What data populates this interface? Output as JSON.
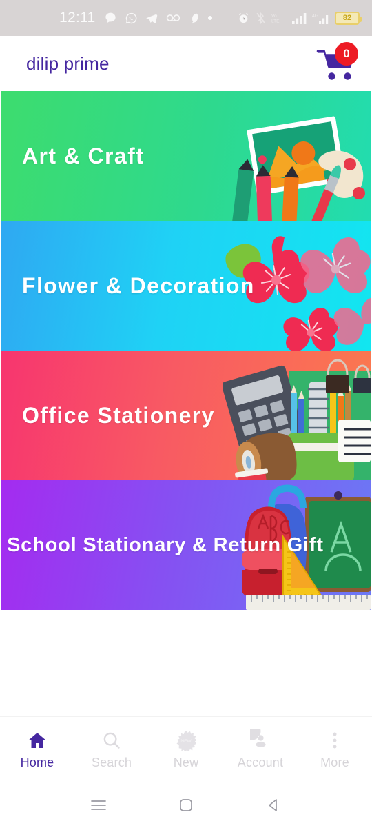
{
  "status_bar": {
    "time": "12:11",
    "battery_level": "82",
    "left_icons": [
      "chat-bubble-icon",
      "whatsapp-icon",
      "telegram-icon",
      "voicemail-icon",
      "feather-icon",
      "dot-icon"
    ],
    "right_icons": [
      "alarm-clock-icon",
      "bluetooth-muted-icon",
      "volte-icon",
      "signal-bars-icon",
      "signal-4g-icon",
      "battery-icon"
    ]
  },
  "app_bar": {
    "title": "dilip prime",
    "cart_icon": "shopping-cart-icon",
    "cart_count": "0",
    "title_color": "#4527a0",
    "badge_color": "#ed1b24"
  },
  "banners": [
    {
      "title": "Art & Craft",
      "art": "art-supplies-illustration",
      "color_start": "#3ddc6e",
      "color_end": "#22dcb0"
    },
    {
      "title": "Flower & Decoration",
      "art": "cherry-blossom-illustration",
      "color_start": "#2fa8f2",
      "color_end": "#12e6f0"
    },
    {
      "title": "Office Stationery",
      "art": "office-supplies-illustration",
      "color_start": "#f7356f",
      "color_end": "#fb7a4e"
    },
    {
      "title": "School Stationary & Return Gift",
      "art": "school-supplies-illustration",
      "color_start": "#a42bf0",
      "color_end": "#6b79f5"
    }
  ],
  "bottom_nav": {
    "active_index": 0,
    "active_color": "#4527a0",
    "inactive_color": "#d6d4d8",
    "items": [
      {
        "label": "Home",
        "icon": "home-icon"
      },
      {
        "label": "Search",
        "icon": "search-icon"
      },
      {
        "label": "New",
        "icon": "starburst-badge-icon"
      },
      {
        "label": "Account",
        "icon": "account-circle-icon"
      },
      {
        "label": "More",
        "icon": "more-vertical-icon"
      }
    ]
  },
  "system_nav": {
    "buttons": [
      {
        "icon": "recents-hamburger-icon"
      },
      {
        "icon": "home-square-icon"
      },
      {
        "icon": "back-triangle-icon"
      }
    ]
  }
}
